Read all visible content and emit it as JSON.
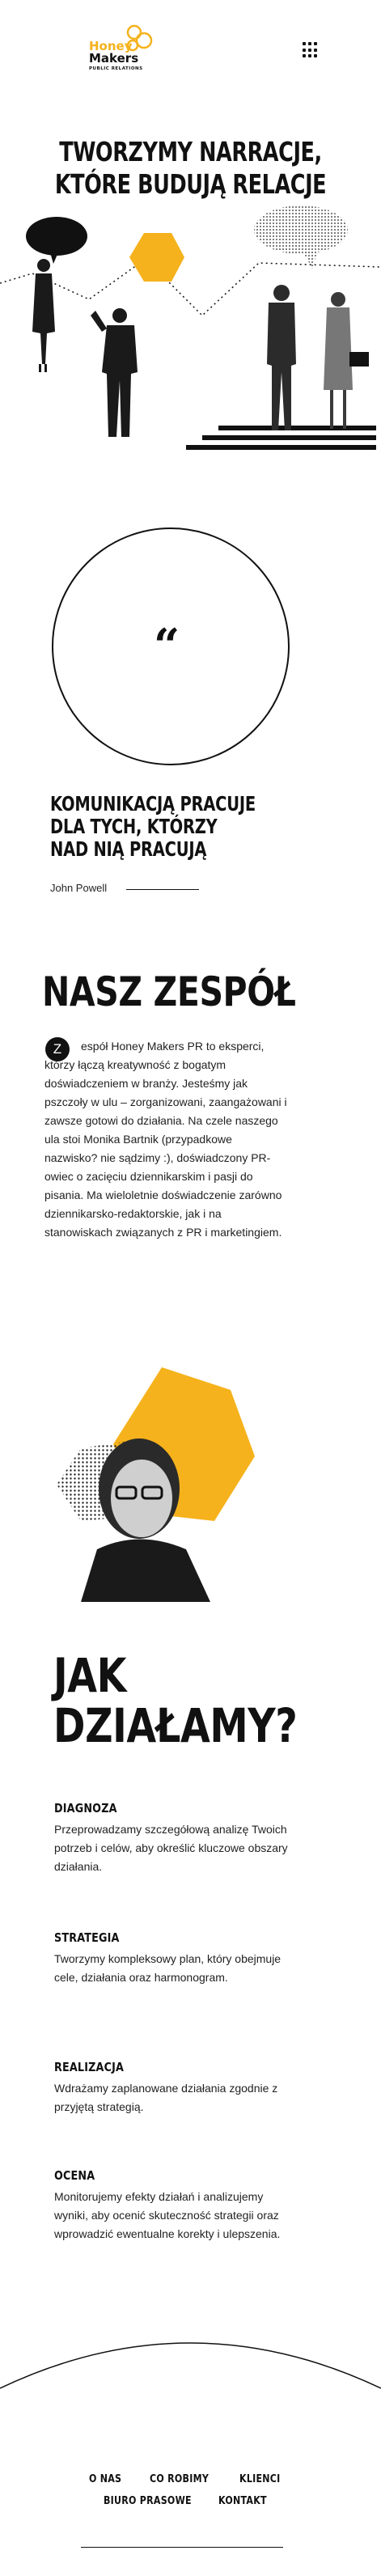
{
  "header": {
    "logo_line1": "Honey",
    "logo_line2": "Makers",
    "logo_tagline": "PUBLIC RELATIONS",
    "menu_icon": "grid-menu-icon"
  },
  "hero": {
    "title_line1": "TWORZYMY NARRACJE,",
    "title_line2": "KTÓRE BUDUJĄ RELACJE"
  },
  "quote": {
    "mark": "“",
    "text": "KOMUNIKACJĄ PRACUJE DLA TYCH, KTÓRZY NAD NIĄ PRACUJĄ",
    "author": "John Powell"
  },
  "team": {
    "title": "NASZ ZESPÓŁ",
    "dropcap": "Z",
    "text": "espół Honey Makers PR to eksperci, którzy łączą kreatywność z bogatym doświadczeniem w branży. Jesteśmy jak pszczoły w ulu – zorganizowani, zaangażowani i zawsze gotowi do działania. Na czele naszego ula stoi Monika Bartnik (przypadkowe nazwisko? nie sądzimy :), doświadczony PR-owiec o zacięciu dziennikarskim i pasji do pisania. Ma wieloletnie doświadczenie zarówno dziennikarsko-redaktorskie, jak i na stanowiskach związanych z PR i marketingiem."
  },
  "how": {
    "title_line1": "JAK",
    "title_line2": "DZIAŁAMY?",
    "steps": [
      {
        "title": "DIAGNOZA",
        "text": "Przeprowadzamy szczegółową analizę Twoich potrzeb i celów, aby określić kluczowe obszary działania."
      },
      {
        "title": "STRATEGIA",
        "text": "Tworzymy kompleksowy plan, który obejmuje cele, działania oraz harmonogram."
      },
      {
        "title": "REALIZACJA",
        "text": "Wdrażamy zaplanowane działania zgodnie z przyjętą strategią."
      },
      {
        "title": "OCENA",
        "text": "Monitorujemy efekty działań i analizujemy wyniki, aby ocenić skuteczność strategii oraz wprowadzić ewentualne korekty i ulepszenia."
      }
    ]
  },
  "footer": {
    "nav": [
      "O NAS",
      "CO ROBIMY",
      "KLIENCI",
      "BIURO PRASOWE",
      "KONTAKT"
    ]
  },
  "colors": {
    "accent": "#F5B21C",
    "text": "#111111",
    "background": "#FFFFFF"
  }
}
